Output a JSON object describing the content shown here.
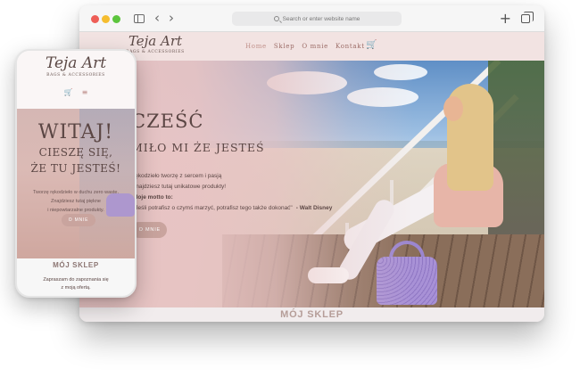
{
  "browser": {
    "address_placeholder": "Search or enter website name",
    "icons": [
      "sidebar-icon",
      "chevron-left-icon",
      "chevron-right-icon",
      "search-icon",
      "plus-icon",
      "tabs-icon"
    ]
  },
  "site": {
    "logo_main": "Teja Art",
    "logo_sub": "BAGS & ACCESSORIES",
    "nav": [
      "Home",
      "Sklep",
      "O mnie",
      "Kontakt"
    ],
    "hero": {
      "title": "CZEŚĆ",
      "subtitle": "MIŁO MI ŻE JESTEŚ",
      "line1": "rękodzieło tworzę z sercem i pasją",
      "line2": "znajdziesz tutaj unikatowe produkty!",
      "motto_label": "Moje motto to:",
      "quote": "\"Jeśli potrafisz o czymś marzyć, potrafisz tego także dokonać\"",
      "quote_author": "- Walt Disney",
      "button": "O MNIE"
    },
    "shop_title": "MÓJ SKLEP"
  },
  "phone": {
    "logo_main": "Teja Art",
    "logo_sub": "BAGS & ACCESSORIES",
    "hero_title": "WITAJ!",
    "hero_sub_1": "CIESZĘ SIĘ,",
    "hero_sub_2": "ŻE TU JESTEŚ!",
    "line1": "Tworzę rękodzieło w duchu zero waste.",
    "line2": "Znajdziesz tutaj piękne",
    "line3": "i niepowtarzalne produkty.",
    "button": "O MNIE",
    "shop_title": "MÓJ SKLEP",
    "shop_text_1": "Zapraszam do zapoznania się",
    "shop_text_2": "z moją ofertą."
  },
  "colors": {
    "accent_pink": "#c9a49e",
    "header_bg": "#f2e3e2",
    "text_dark": "#5b4644",
    "bag_lilac": "#a891d6"
  }
}
